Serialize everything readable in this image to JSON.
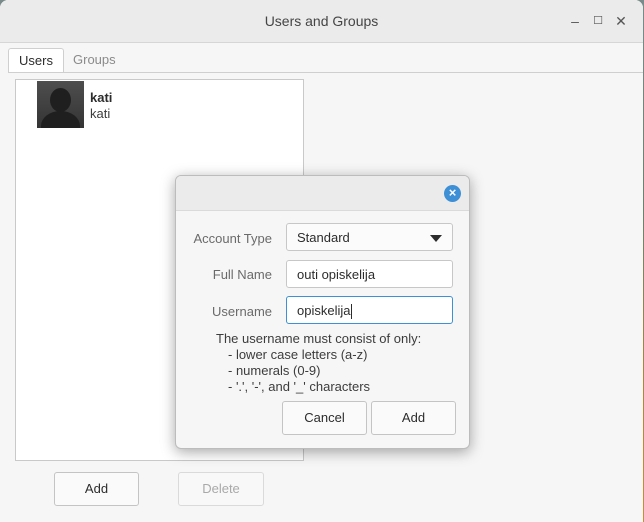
{
  "window": {
    "title": "Users and Groups",
    "minimize_icon": "minimize-icon",
    "maximize_icon": "maximize-icon",
    "close_icon": "close-icon"
  },
  "tabs": [
    {
      "label": "Users",
      "active": true
    },
    {
      "label": "Groups",
      "active": false
    }
  ],
  "users": [
    {
      "name": "kati",
      "login": "kati"
    }
  ],
  "buttons": {
    "add": "Add",
    "delete": "Delete"
  },
  "dialog": {
    "account_type_label": "Account Type",
    "account_type_value": "Standard",
    "full_name_label": "Full Name",
    "full_name_value": "outi opiskelija",
    "username_label": "Username",
    "username_value": "opiskelija",
    "hint_title": "The username must consist of only:",
    "hint_items": [
      "- lower case letters (a-z)",
      "- numerals (0-9)",
      "- '.', '-', and '_' characters"
    ],
    "cancel_label": "Cancel",
    "add_label": "Add",
    "accent": "#3d8fd6"
  }
}
